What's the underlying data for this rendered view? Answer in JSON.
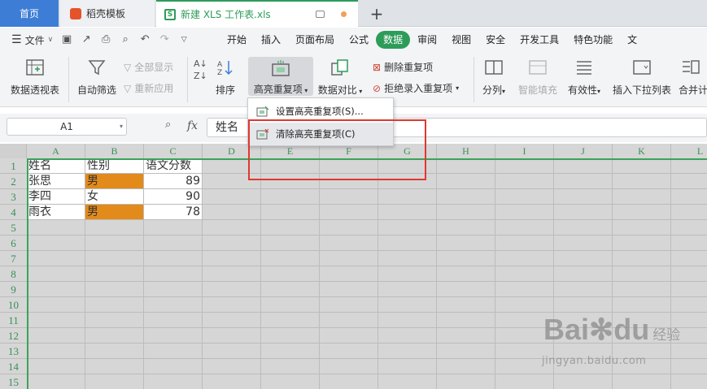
{
  "tabs": {
    "home": "首页",
    "templates": "稻壳模板",
    "file": "新建 XLS 工作表.xls",
    "add": "+"
  },
  "menu": {
    "file_label": "文件",
    "tabs": [
      "开始",
      "插入",
      "页面布局",
      "公式",
      "数据",
      "审阅",
      "视图",
      "安全",
      "开发工具",
      "特色功能",
      "文"
    ],
    "active_tab": "数据"
  },
  "ribbon": {
    "pivot": "数据透视表",
    "autofilter": "自动筛选",
    "show_all": "全部显示",
    "reapply": "重新应用",
    "sort": "排序",
    "highlight_dup": "高亮重复项",
    "compare": "数据对比",
    "delete_dup": "删除重复项",
    "reject_dup": "拒绝录入重复项",
    "split": "分列",
    "smart_fill": "智能填充",
    "validity": "有效性",
    "insert_dropdown": "插入下拉列表",
    "merge_calc": "合并计"
  },
  "dropdown": {
    "items": [
      "设置高亮重复项(S)...",
      "清除高亮重复项(C)"
    ]
  },
  "formula_bar": {
    "cell_ref": "A1",
    "fx": "fx",
    "value": "姓名"
  },
  "sheet": {
    "columns": [
      "A",
      "B",
      "C",
      "D",
      "E",
      "F",
      "G",
      "H",
      "I",
      "J",
      "K",
      "L"
    ],
    "rows": [
      "1",
      "2",
      "3",
      "4",
      "5",
      "6",
      "7",
      "8",
      "9",
      "10",
      "11",
      "12",
      "13",
      "14",
      "15"
    ],
    "data": [
      [
        "姓名",
        "性别",
        "语文分数"
      ],
      [
        "张思",
        "男",
        "89"
      ],
      [
        "李四",
        "女",
        "90"
      ],
      [
        "雨衣",
        "男",
        "78"
      ]
    ],
    "highlight_color": "#e28a1a"
  },
  "watermark": {
    "brand": "Bai",
    "brand2": "du",
    "cn": "经验",
    "url": "jingyan.baidu.com"
  },
  "colors": {
    "accent": "#2d9c59",
    "home_tab": "#3d7dd6",
    "red_box": "#e0382f"
  }
}
